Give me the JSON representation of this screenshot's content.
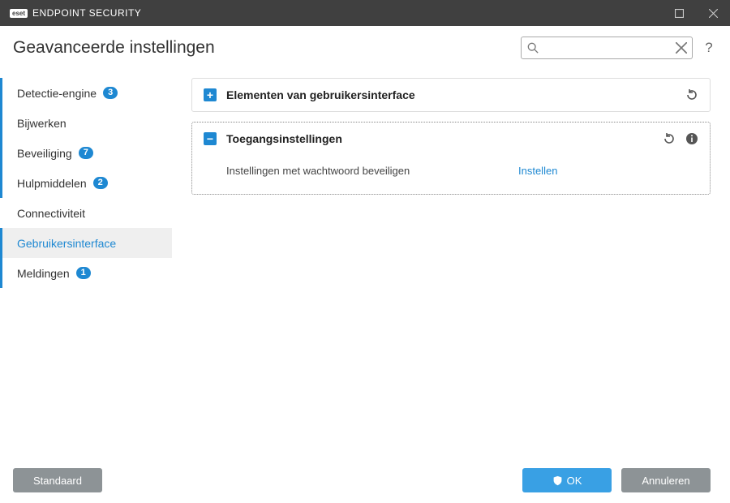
{
  "app": {
    "brand_badge": "eset",
    "brand_name": "ENDPOINT SECURITY"
  },
  "page_title": "Geavanceerde instellingen",
  "search": {
    "value": "",
    "placeholder": ""
  },
  "sidebar": {
    "items": [
      {
        "label": "Detectie-engine",
        "badge": "3",
        "accented": true,
        "selected": false
      },
      {
        "label": "Bijwerken",
        "badge": null,
        "accented": true,
        "selected": false
      },
      {
        "label": "Beveiliging",
        "badge": "7",
        "accented": true,
        "selected": false
      },
      {
        "label": "Hulpmiddelen",
        "badge": "2",
        "accented": true,
        "selected": false
      },
      {
        "label": "Connectiviteit",
        "badge": null,
        "accented": false,
        "selected": false
      },
      {
        "label": "Gebruikersinterface",
        "badge": null,
        "accented": true,
        "selected": true
      },
      {
        "label": "Meldingen",
        "badge": "1",
        "accented": true,
        "selected": false
      }
    ]
  },
  "panels": {
    "ui_elements": {
      "title": "Elementen van gebruikersinterface",
      "expanded": false
    },
    "access": {
      "title": "Toegangsinstellingen",
      "expanded": true,
      "rows": [
        {
          "label": "Instellingen met wachtwoord beveiligen",
          "action": "Instellen"
        }
      ]
    }
  },
  "footer": {
    "default": "Standaard",
    "ok": "OK",
    "cancel": "Annuleren"
  }
}
